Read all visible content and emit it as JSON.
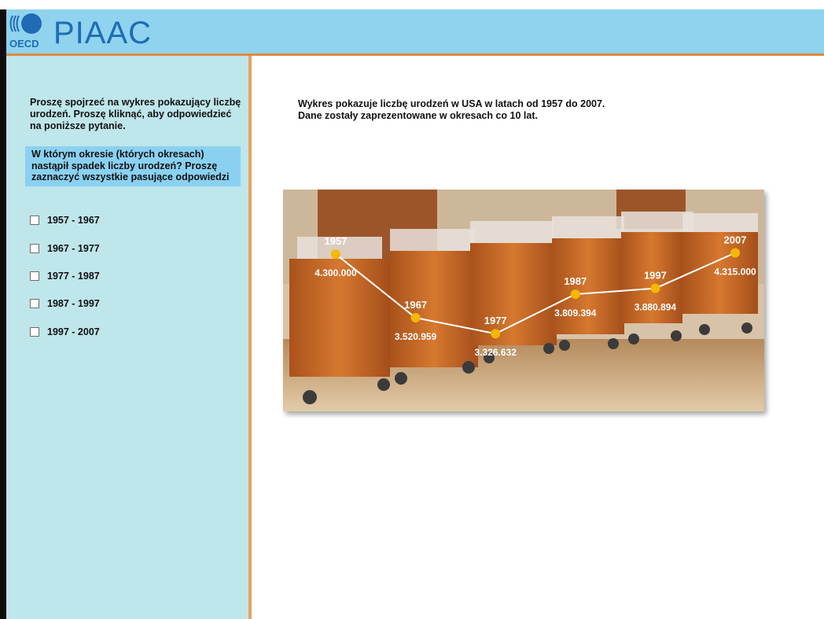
{
  "header": {
    "logo_text": "OECD",
    "app_title": "PIAAC"
  },
  "sidebar": {
    "instructions": "Proszę spojrzeć na wykres pokazujący liczbę urodzeń. Proszę kliknąć, aby odpowiedzieć na poniższe pytanie.",
    "question": "W którym okresie (których okresach) nastąpił spadek liczby urodzeń? Proszę zaznaczyć wszystkie pasujące odpowiedzi",
    "options": [
      {
        "label": "1957 - 1967",
        "checked": false
      },
      {
        "label": "1967 - 1977",
        "checked": false
      },
      {
        "label": "1977 - 1987",
        "checked": false
      },
      {
        "label": "1987 - 1997",
        "checked": false
      },
      {
        "label": "1997 - 2007",
        "checked": false
      }
    ]
  },
  "main": {
    "description_line1": "Wykres pokazuje liczbę urodzeń w USA w latach od 1957 do 2007.",
    "description_line2": "Dane zostały zaprezentowane w okresach co 10 lat."
  },
  "chart_data": {
    "type": "line",
    "x": [
      "1957",
      "1967",
      "1977",
      "1987",
      "1997",
      "2007"
    ],
    "values": [
      4300000,
      3520959,
      3326632,
      3809394,
      3880894,
      4315000
    ],
    "value_labels": [
      "4.300.000",
      "3.520.959",
      "3.326.632",
      "3.809.394",
      "3.880.894",
      "4.315.000"
    ],
    "line_color": "#ffffff",
    "marker_color": "#f5b800",
    "grid": false
  },
  "colors": {
    "header_bg": "#8fd3ee",
    "sidebar_bg": "#bfe6ea",
    "question_bg": "#8ad1f1",
    "accent_orange": "#e08a3c",
    "title_blue": "#1f6cb4"
  }
}
